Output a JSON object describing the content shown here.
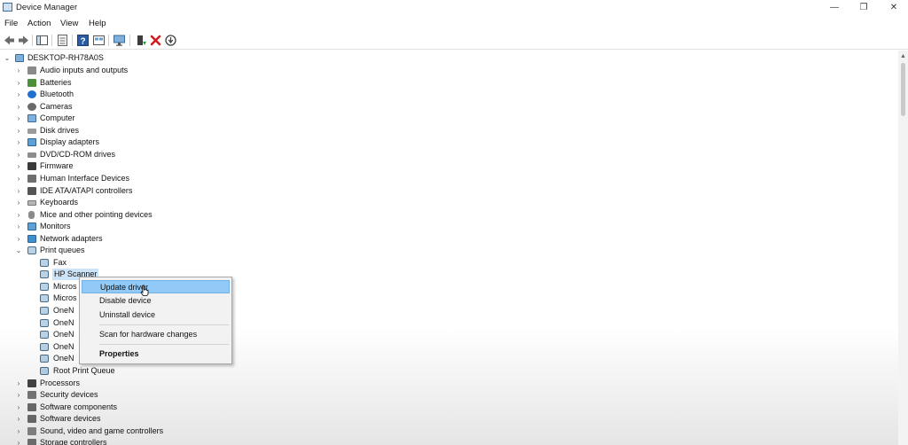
{
  "window": {
    "title": "Device Manager",
    "minimize_glyph": "—",
    "maximize_glyph": "❐",
    "close_glyph": "✕"
  },
  "menu": [
    "File",
    "Action",
    "View",
    "Help"
  ],
  "toolbar": {
    "icons": [
      "back-icon",
      "forward-icon",
      "show-hide-console-tree-icon",
      "properties-icon",
      "help-icon",
      "view-icon",
      "monitor-icon",
      "update-driver-icon",
      "uninstall-icon",
      "scan-icon"
    ]
  },
  "tree": {
    "root": "DESKTOP-RH78A0S",
    "categories": [
      {
        "label": "Audio inputs and outputs",
        "icon": "speaker-icon"
      },
      {
        "label": "Batteries",
        "icon": "battery-icon"
      },
      {
        "label": "Bluetooth",
        "icon": "bluetooth-icon"
      },
      {
        "label": "Cameras",
        "icon": "camera-icon"
      },
      {
        "label": "Computer",
        "icon": "computer-icon"
      },
      {
        "label": "Disk drives",
        "icon": "disk-icon"
      },
      {
        "label": "Display adapters",
        "icon": "display-icon"
      },
      {
        "label": "DVD/CD-ROM drives",
        "icon": "dvd-icon"
      },
      {
        "label": "Firmware",
        "icon": "chip-icon"
      },
      {
        "label": "Human Interface Devices",
        "icon": "hid-icon"
      },
      {
        "label": "IDE ATA/ATAPI controllers",
        "icon": "ide-icon"
      },
      {
        "label": "Keyboards",
        "icon": "keyboard-icon"
      },
      {
        "label": "Mice and other pointing devices",
        "icon": "mouse-icon"
      },
      {
        "label": "Monitors",
        "icon": "monitor-icon"
      },
      {
        "label": "Network adapters",
        "icon": "network-icon"
      },
      {
        "label": "Print queues",
        "icon": "printer-icon",
        "expanded": true
      }
    ],
    "print_queue_children": [
      "Fax",
      "HP Scanner",
      "Micros",
      "Micros",
      "OneN",
      "OneN",
      "OneN",
      "OneN",
      "OneN",
      "Root Print Queue"
    ],
    "categories_after": [
      {
        "label": "Processors",
        "icon": "processor-icon"
      },
      {
        "label": "Security devices",
        "icon": "security-icon"
      },
      {
        "label": "Software components",
        "icon": "component-icon"
      },
      {
        "label": "Software devices",
        "icon": "software-icon"
      },
      {
        "label": "Sound, video and game controllers",
        "icon": "sound-icon"
      },
      {
        "label": "Storage controllers",
        "icon": "storage-icon"
      }
    ]
  },
  "context_menu": {
    "items": [
      {
        "label": "Update driver",
        "highlighted": true
      },
      {
        "label": "Disable device"
      },
      {
        "label": "Uninstall device"
      },
      {
        "label": "Scan for hardware changes"
      },
      {
        "label": "Properties",
        "bold": true
      }
    ]
  }
}
